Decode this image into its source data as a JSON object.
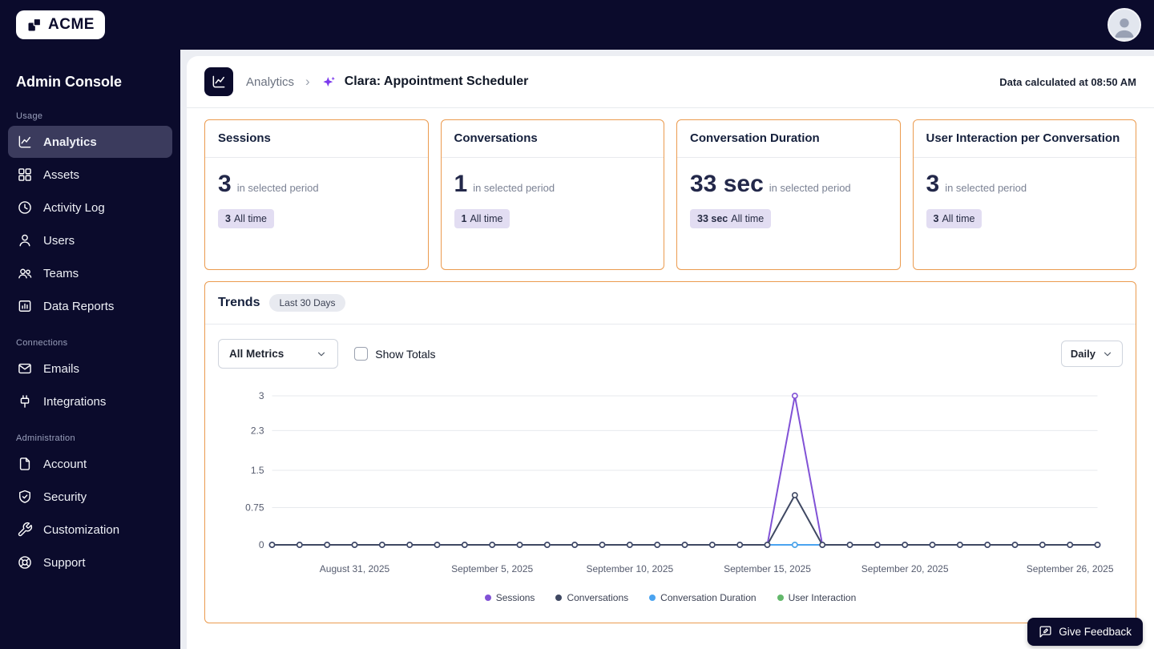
{
  "topbar": {
    "logo_text": "ACME"
  },
  "sidebar": {
    "title": "Admin Console",
    "sections": [
      {
        "label": "Usage",
        "items": [
          {
            "label": "Analytics"
          },
          {
            "label": "Assets"
          },
          {
            "label": "Activity Log"
          },
          {
            "label": "Users"
          },
          {
            "label": "Teams"
          },
          {
            "label": "Data Reports"
          }
        ]
      },
      {
        "label": "Connections",
        "items": [
          {
            "label": "Emails"
          },
          {
            "label": "Integrations"
          }
        ]
      },
      {
        "label": "Administration",
        "items": [
          {
            "label": "Account"
          },
          {
            "label": "Security"
          },
          {
            "label": "Customization"
          },
          {
            "label": "Support"
          }
        ]
      }
    ]
  },
  "header": {
    "breadcrumb": {
      "root": "Analytics",
      "separator": "›",
      "current": "Clara: Appointment Scheduler"
    },
    "calculated_at": "Data calculated at 08:50 AM"
  },
  "metrics": [
    {
      "title": "Sessions",
      "value": "3",
      "period_label": "in selected period",
      "alltime_value": "3",
      "alltime_label": "All time"
    },
    {
      "title": "Conversations",
      "value": "1",
      "period_label": "in selected period",
      "alltime_value": "1",
      "alltime_label": "All time"
    },
    {
      "title": "Conversation Duration",
      "value": "33 sec",
      "period_label": "in selected period",
      "alltime_value": "33 sec",
      "alltime_label": "All time"
    },
    {
      "title": "User Interaction per Conversation",
      "value": "3",
      "period_label": "in selected period",
      "alltime_value": "3",
      "alltime_label": "All time"
    }
  ],
  "trends": {
    "title": "Trends",
    "range_badge": "Last 30 Days",
    "metric_filter": "All Metrics",
    "show_totals_label": "Show Totals",
    "interval": "Daily"
  },
  "chart_data": {
    "type": "line",
    "x": [
      "2025-08-28",
      "2025-08-29",
      "2025-08-30",
      "2025-08-31",
      "2025-09-01",
      "2025-09-02",
      "2025-09-03",
      "2025-09-04",
      "2025-09-05",
      "2025-09-06",
      "2025-09-07",
      "2025-09-08",
      "2025-09-09",
      "2025-09-10",
      "2025-09-11",
      "2025-09-12",
      "2025-09-13",
      "2025-09-14",
      "2025-09-15",
      "2025-09-16",
      "2025-09-17",
      "2025-09-18",
      "2025-09-19",
      "2025-09-20",
      "2025-09-21",
      "2025-09-22",
      "2025-09-23",
      "2025-09-24",
      "2025-09-25",
      "2025-09-26",
      "2025-09-27"
    ],
    "xtick_indices": [
      3,
      8,
      13,
      18,
      23,
      29
    ],
    "xtick_labels": [
      "August 31, 2025",
      "September 5, 2025",
      "September 10, 2025",
      "September 15, 2025",
      "September 20, 2025",
      "September 26, 2025"
    ],
    "yticks": [
      {
        "v": 0,
        "label": "0"
      },
      {
        "v": 0.75,
        "label": "0.75"
      },
      {
        "v": 1.5,
        "label": "1.5"
      },
      {
        "v": 2.3,
        "label": "2.3"
      },
      {
        "v": 3,
        "label": "3"
      }
    ],
    "ylim": [
      0,
      3
    ],
    "grid": true,
    "legend_position": "bottom",
    "draw_order": [
      3,
      2,
      0,
      1
    ],
    "series": [
      {
        "name": "Sessions",
        "color": "#8152d6",
        "values": [
          0,
          0,
          0,
          0,
          0,
          0,
          0,
          0,
          0,
          0,
          0,
          0,
          0,
          0,
          0,
          0,
          0,
          0,
          0,
          3,
          0,
          0,
          0,
          0,
          0,
          0,
          0,
          0,
          0,
          0,
          0
        ]
      },
      {
        "name": "Conversations",
        "color": "#3f4862",
        "values": [
          0,
          0,
          0,
          0,
          0,
          0,
          0,
          0,
          0,
          0,
          0,
          0,
          0,
          0,
          0,
          0,
          0,
          0,
          0,
          1,
          0,
          0,
          0,
          0,
          0,
          0,
          0,
          0,
          0,
          0,
          0
        ]
      },
      {
        "name": "Conversation Duration",
        "color": "#4aa3f0",
        "values": [
          0,
          0,
          0,
          0,
          0,
          0,
          0,
          0,
          0,
          0,
          0,
          0,
          0,
          0,
          0,
          0,
          0,
          0,
          0,
          0,
          0,
          0,
          0,
          0,
          0,
          0,
          0,
          0,
          0,
          0,
          0
        ]
      },
      {
        "name": "User Interaction",
        "color": "#63b86b",
        "values": [
          0,
          0,
          0,
          0,
          0,
          0,
          0,
          0,
          0,
          0,
          0,
          0,
          0,
          0,
          0,
          0,
          0,
          0,
          0,
          0,
          0,
          0,
          0,
          0,
          0,
          0,
          0,
          0,
          0,
          0,
          0
        ]
      }
    ]
  },
  "feedback": {
    "label": "Give Feedback"
  }
}
